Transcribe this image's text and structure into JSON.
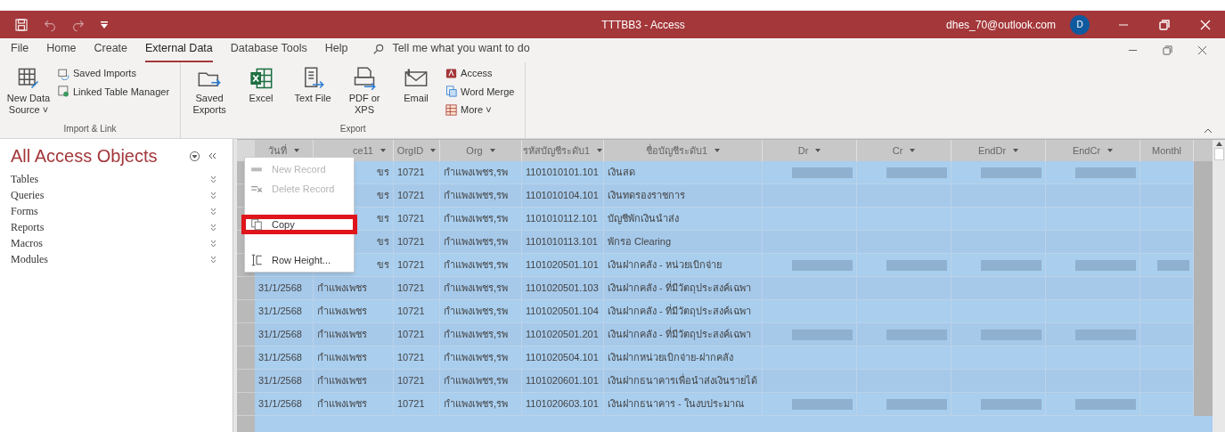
{
  "window": {
    "title": "TTTBB3 - Access",
    "account": "dhes_70@outlook.com",
    "avatar": "D"
  },
  "tabs": [
    {
      "label": "File",
      "selected": false
    },
    {
      "label": "Home",
      "selected": false
    },
    {
      "label": "Create",
      "selected": false
    },
    {
      "label": "External Data",
      "selected": true
    },
    {
      "label": "Database Tools",
      "selected": false
    },
    {
      "label": "Help",
      "selected": false
    }
  ],
  "search": {
    "placeholder": "Tell me what you want to do"
  },
  "ribbon": {
    "groups": [
      {
        "label": "Import & Link",
        "large": [
          "New Data Source ˅"
        ],
        "small": [
          "Saved Imports",
          "Linked Table Manager"
        ]
      },
      {
        "label": "Export",
        "large": [
          "Saved Exports",
          "Excel",
          "Text File",
          "PDF or XPS",
          "Email"
        ],
        "small": [
          "Access",
          "Word Merge",
          "More ˅"
        ]
      }
    ]
  },
  "nav": {
    "title": "All Access Objects",
    "items": [
      "Tables",
      "Queries",
      "Forms",
      "Reports",
      "Macros",
      "Modules"
    ]
  },
  "table": {
    "columns": [
      "วันที่",
      "ce11",
      "OrgID",
      "Org",
      "รหัสบัญชีระดับ1",
      "ชื่อบัญชีระดับ1",
      "Dr",
      "Cr",
      "EndDr",
      "EndCr",
      "Monthl"
    ],
    "rows": [
      {
        "selected": true,
        "cells": [
          null,
          "ขร",
          "10721",
          "กำแพงเพชร,รพ",
          "1101010101.101",
          "เงินสด"
        ],
        "blurred": [
          true,
          true,
          true,
          true,
          false
        ]
      },
      {
        "selected": true,
        "cells": [
          null,
          "ขร",
          "10721",
          "กำแพงเพชร,รพ",
          "1101010104.101",
          "เงินทดรองราชการ"
        ],
        "blurred": [
          false,
          false,
          false,
          false,
          false
        ]
      },
      {
        "selected": true,
        "cells": [
          null,
          "ขร",
          "10721",
          "กำแพงเพชร,รพ",
          "1101010112.101",
          "บัญชีพักเงินนำส่ง"
        ],
        "blurred": [
          false,
          false,
          false,
          false,
          false
        ]
      },
      {
        "selected": true,
        "cells": [
          null,
          "ขร",
          "10721",
          "กำแพงเพชร,รพ",
          "1101010113.101",
          "พักรอ Clearing"
        ],
        "blurred": [
          false,
          false,
          false,
          false,
          false
        ]
      },
      {
        "selected": true,
        "cells": [
          null,
          "ขร",
          "10721",
          "กำแพงเพชร,รพ",
          "1101020501.101",
          "เงินฝากคลัง - หน่วยเบิกจ่าย"
        ],
        "blurred": [
          true,
          true,
          true,
          true,
          true
        ]
      },
      {
        "selected": true,
        "cells": [
          "31/1/2568",
          "กำแพงเพชร",
          "10721",
          "กำแพงเพชร,รพ",
          "1101020501.103",
          "เงินฝากคลัง - ที่มีวัตถุประสงค์เฉพา"
        ],
        "blurred": [
          false,
          false,
          false,
          false,
          false
        ]
      },
      {
        "selected": true,
        "cells": [
          "31/1/2568",
          "กำแพงเพชร",
          "10721",
          "กำแพงเพชร,รพ",
          "1101020501.104",
          "เงินฝากคลัง - ที่มีวัตถุประสงค์เฉพา"
        ],
        "blurred": [
          false,
          false,
          false,
          false,
          false
        ]
      },
      {
        "selected": true,
        "cells": [
          "31/1/2568",
          "กำแพงเพชร",
          "10721",
          "กำแพงเพชร,รพ",
          "1101020501.201",
          "เงินฝากคลัง - ที่มีวัตถุประสงค์เฉพา"
        ],
        "blurred": [
          true,
          true,
          true,
          true,
          false
        ]
      },
      {
        "selected": true,
        "cells": [
          "31/1/2568",
          "กำแพงเพชร",
          "10721",
          "กำแพงเพชร,รพ",
          "1101020504.101",
          "เงินฝากหน่วยเบิกจ่าย-ฝากคลัง"
        ],
        "blurred": [
          false,
          false,
          false,
          false,
          false
        ]
      },
      {
        "selected": true,
        "cells": [
          "31/1/2568",
          "กำแพงเพชร",
          "10721",
          "กำแพงเพชร,รพ",
          "1101020601.101",
          "เงินฝากธนาคารเพื่อนำส่งเงินรายได้"
        ],
        "blurred": [
          false,
          false,
          false,
          false,
          false
        ]
      },
      {
        "selected": true,
        "cells": [
          "31/1/2568",
          "กำแพงเพชร",
          "10721",
          "กำแพงเพชร,รพ",
          "1101020603.101",
          "เงินฝากธนาคาร -  ในงบประมาณ"
        ],
        "blurred": [
          true,
          true,
          true,
          true,
          false
        ]
      }
    ]
  },
  "context_menu": {
    "items": [
      {
        "kind": "item",
        "label": "New Record",
        "disabled": true,
        "highlighted": false
      },
      {
        "kind": "item",
        "label": "Delete Record",
        "disabled": true,
        "highlighted": false
      },
      {
        "kind": "hidden"
      },
      {
        "kind": "item",
        "label": "Copy",
        "disabled": false,
        "highlighted": true
      },
      {
        "kind": "hidden"
      },
      {
        "kind": "item",
        "label": "Row Height...",
        "disabled": false,
        "highlighted": false
      }
    ]
  }
}
